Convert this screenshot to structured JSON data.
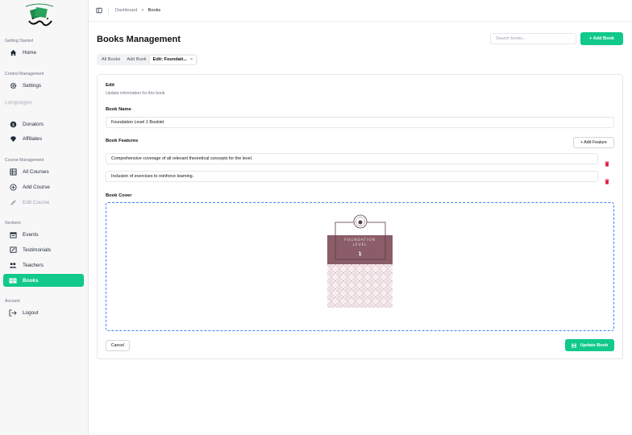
{
  "sidebar": {
    "logo_text": "كتاب",
    "groups": {
      "getting_started": "Getting Started",
      "control_management": "Control Management",
      "course_management": "Course Management",
      "sections": "Sections",
      "account": "Account"
    },
    "items": {
      "home": "Home",
      "settings": "Settings",
      "donators": "Donators",
      "affiliates": "Affiliates",
      "all_courses": "All Courses",
      "add_course": "Add Course",
      "edit_course": "Edit Course",
      "events": "Events",
      "testimonials": "Testimonials",
      "teachers": "Teachers",
      "books": "Books",
      "logout": "Logout"
    },
    "blurred_item": "Languages"
  },
  "topbar": {
    "breadcrumb": [
      "Dashboard",
      "Books"
    ],
    "separator": ">"
  },
  "header": {
    "title": "Books Management",
    "search_placeholder": "Search books...",
    "add_button": "+ Add Book"
  },
  "tabs": [
    {
      "label": "All Books"
    },
    {
      "label": "Add Book"
    },
    {
      "label": "Edit: Foundati...",
      "close": "×"
    }
  ],
  "form": {
    "section_title": "Edit",
    "section_subtitle": "Update information for this book",
    "book_name_label": "Book Name",
    "book_name_value": "Foundation Level 1 Booklet",
    "features_label": "Book Features",
    "add_feature_button": "+ Add Feature",
    "features": [
      "Comprehensive coverage of all relevant theoretical concepts for the level.",
      "Inclusion of exercises to reinforce learning."
    ],
    "cover_label": "Book Cover",
    "cancel_button": "Cancel",
    "update_button": "Update Book"
  },
  "cover": {
    "line1": "FOUNDATION",
    "line2": "LEVEL",
    "number": "1",
    "band_color": "#8a5d68",
    "pattern_color": "#d8b8c0"
  },
  "colors": {
    "accent": "#10c98a",
    "danger": "#e11d48",
    "dropzone": "#3b82f6"
  }
}
